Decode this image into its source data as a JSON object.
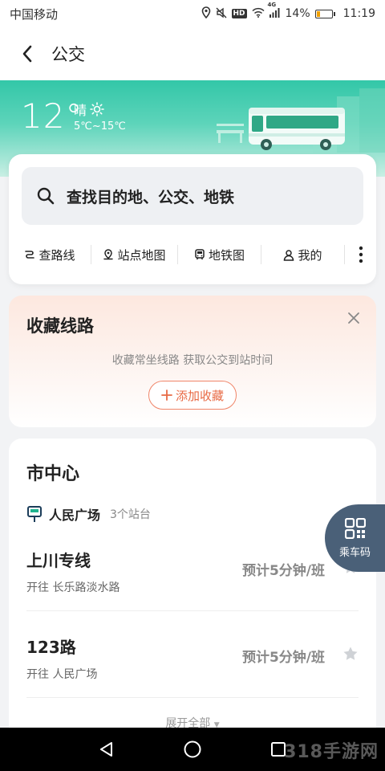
{
  "status_bar": {
    "carrier": "中国移动",
    "network": "4G",
    "battery": "14%",
    "time": "11:19",
    "hd_badge": "HD"
  },
  "header": {
    "title": "公交"
  },
  "weather": {
    "temperature": "12°",
    "condition": "晴",
    "range": "5℃~15℃"
  },
  "search": {
    "placeholder": "查找目的地、公交、地铁",
    "quick_links": [
      {
        "label": "查路线",
        "icon": "route-icon"
      },
      {
        "label": "站点地图",
        "icon": "map-pin-icon"
      },
      {
        "label": "地铁图",
        "icon": "subway-icon"
      },
      {
        "label": "我的",
        "icon": "person-icon"
      }
    ]
  },
  "favorites": {
    "title": "收藏线路",
    "hint": "收藏常坐线路 获取公交到站时间",
    "add_label": "添加收藏"
  },
  "nearby": {
    "title": "市中心",
    "station_name": "人民广场",
    "station_count": "3个站台",
    "routes": [
      {
        "name": "上川专线",
        "destination": "开往 长乐路淡水路",
        "eta": "预计5分钟/班"
      },
      {
        "name": "123路",
        "destination": "开往 人民广场",
        "eta": "预计5分钟/班"
      }
    ],
    "expand_label": "展开全部"
  },
  "qr_button": {
    "label": "乘车码"
  },
  "watermark": "318手游网",
  "colors": {
    "accent": "#33c7a8",
    "fav_accent": "#e86a44",
    "qr_bg": "#4a6078"
  }
}
